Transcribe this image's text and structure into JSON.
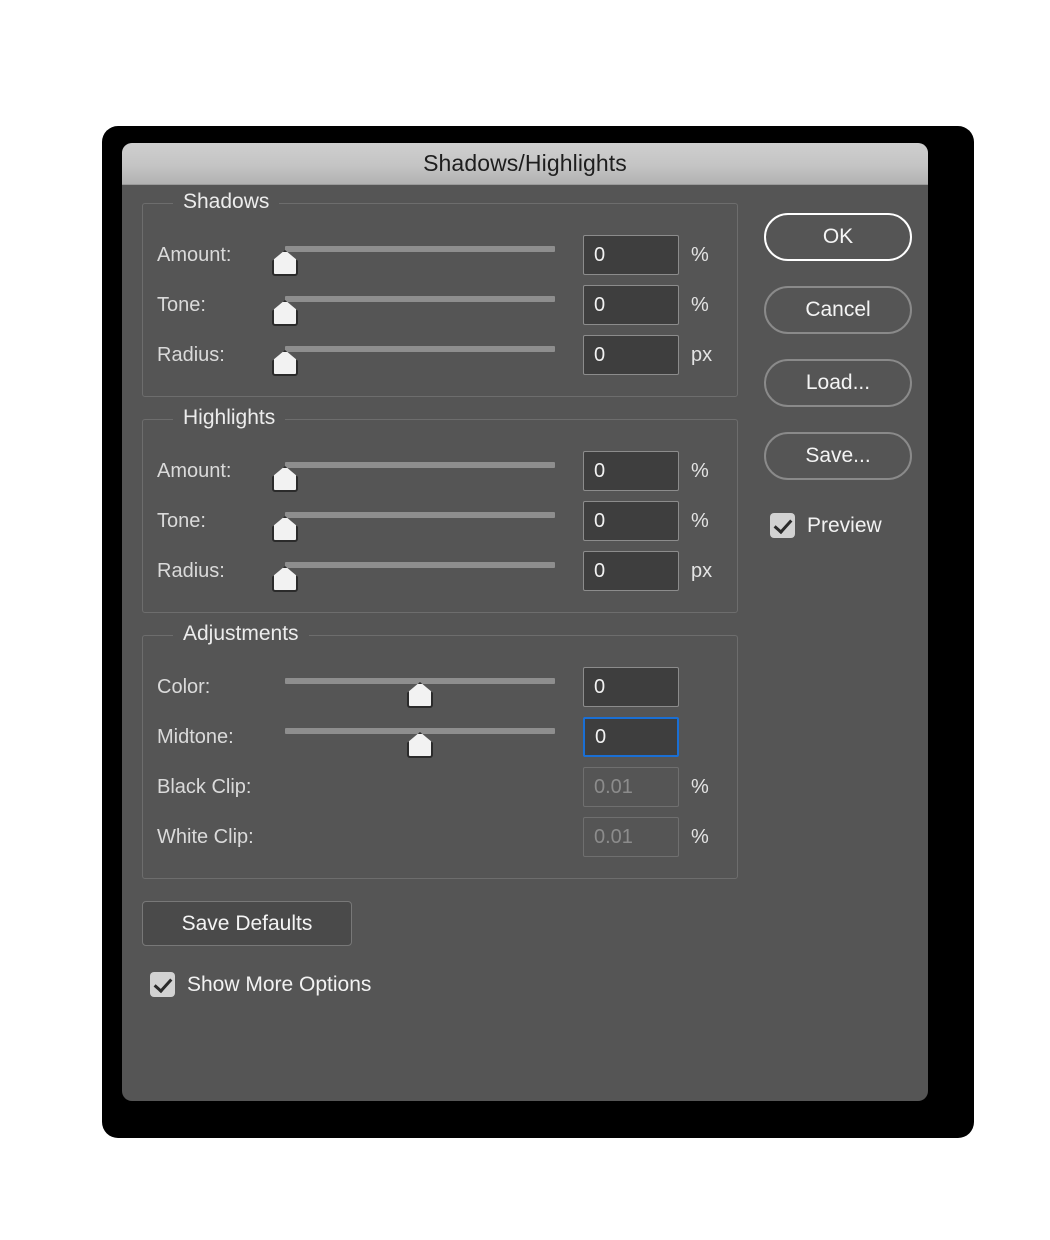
{
  "dialog": {
    "title": "Shadows/Highlights"
  },
  "sections": [
    {
      "legend": "Shadows",
      "rows": [
        {
          "label": "Amount:",
          "value": "0",
          "unit": "%",
          "slider": true,
          "thumb_pct": 0,
          "disabled": false,
          "focused": false
        },
        {
          "label": "Tone:",
          "value": "0",
          "unit": "%",
          "slider": true,
          "thumb_pct": 0,
          "disabled": false,
          "focused": false
        },
        {
          "label": "Radius:",
          "value": "0",
          "unit": "px",
          "slider": true,
          "thumb_pct": 0,
          "disabled": false,
          "focused": false
        }
      ]
    },
    {
      "legend": "Highlights",
      "rows": [
        {
          "label": "Amount:",
          "value": "0",
          "unit": "%",
          "slider": true,
          "thumb_pct": 0,
          "disabled": false,
          "focused": false
        },
        {
          "label": "Tone:",
          "value": "0",
          "unit": "%",
          "slider": true,
          "thumb_pct": 0,
          "disabled": false,
          "focused": false
        },
        {
          "label": "Radius:",
          "value": "0",
          "unit": "px",
          "slider": true,
          "thumb_pct": 0,
          "disabled": false,
          "focused": false
        }
      ]
    },
    {
      "legend": "Adjustments",
      "rows": [
        {
          "label": "Color:",
          "value": "0",
          "unit": "",
          "slider": true,
          "thumb_pct": 50,
          "disabled": false,
          "focused": false
        },
        {
          "label": "Midtone:",
          "value": "0",
          "unit": "",
          "slider": true,
          "thumb_pct": 50,
          "disabled": false,
          "focused": true
        },
        {
          "label": "Black Clip:",
          "value": "0.01",
          "unit": "%",
          "slider": false,
          "thumb_pct": 0,
          "disabled": true,
          "focused": false
        },
        {
          "label": "White Clip:",
          "value": "0.01",
          "unit": "%",
          "slider": false,
          "thumb_pct": 0,
          "disabled": true,
          "focused": false
        }
      ]
    }
  ],
  "buttons": {
    "ok": "OK",
    "cancel": "Cancel",
    "load": "Load...",
    "save": "Save...",
    "save_defaults": "Save Defaults"
  },
  "checkboxes": {
    "preview": {
      "label": "Preview",
      "checked": true
    },
    "show_more_options": {
      "label": "Show More Options",
      "checked": true
    }
  },
  "colors": {
    "dialog_bg": "#555555",
    "titlebar_top": "#cfcfcf",
    "titlebar_bottom": "#b2b2b2",
    "field_bg": "#3e3e3e",
    "focus_blue": "#1a6fd4",
    "track": "#8e8e8e",
    "thumb": "#f2f2f2"
  }
}
